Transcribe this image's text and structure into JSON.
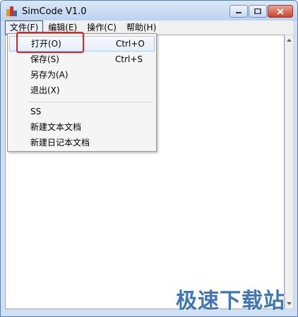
{
  "window": {
    "title": "SimCode V1.0"
  },
  "menubar": {
    "items": [
      {
        "label": "文件(F)"
      },
      {
        "label": "编辑(E)"
      },
      {
        "label": "操作(C)"
      },
      {
        "label": "帮助(H)"
      }
    ]
  },
  "file_menu": {
    "items": [
      {
        "label": "打开(O)",
        "shortcut": "Ctrl+O"
      },
      {
        "label": "保存(S)",
        "shortcut": "Ctrl+S"
      },
      {
        "label": "另存为(A)",
        "shortcut": ""
      },
      {
        "label": "退出(X)",
        "shortcut": ""
      },
      {
        "label": "SS",
        "shortcut": ""
      },
      {
        "label": "新建文本文档",
        "shortcut": ""
      },
      {
        "label": "新建日记本文档",
        "shortcut": ""
      }
    ]
  },
  "watermark": {
    "text": "极速下载站"
  },
  "colors": {
    "highlight_box": "#e2231a",
    "watermark": "#1f5fa8",
    "menu_active_border": "#2b5aa6"
  },
  "icons": [
    "app-icon",
    "minimize-icon",
    "maximize-icon",
    "close-icon",
    "scroll-up-icon",
    "scroll-down-icon"
  ]
}
